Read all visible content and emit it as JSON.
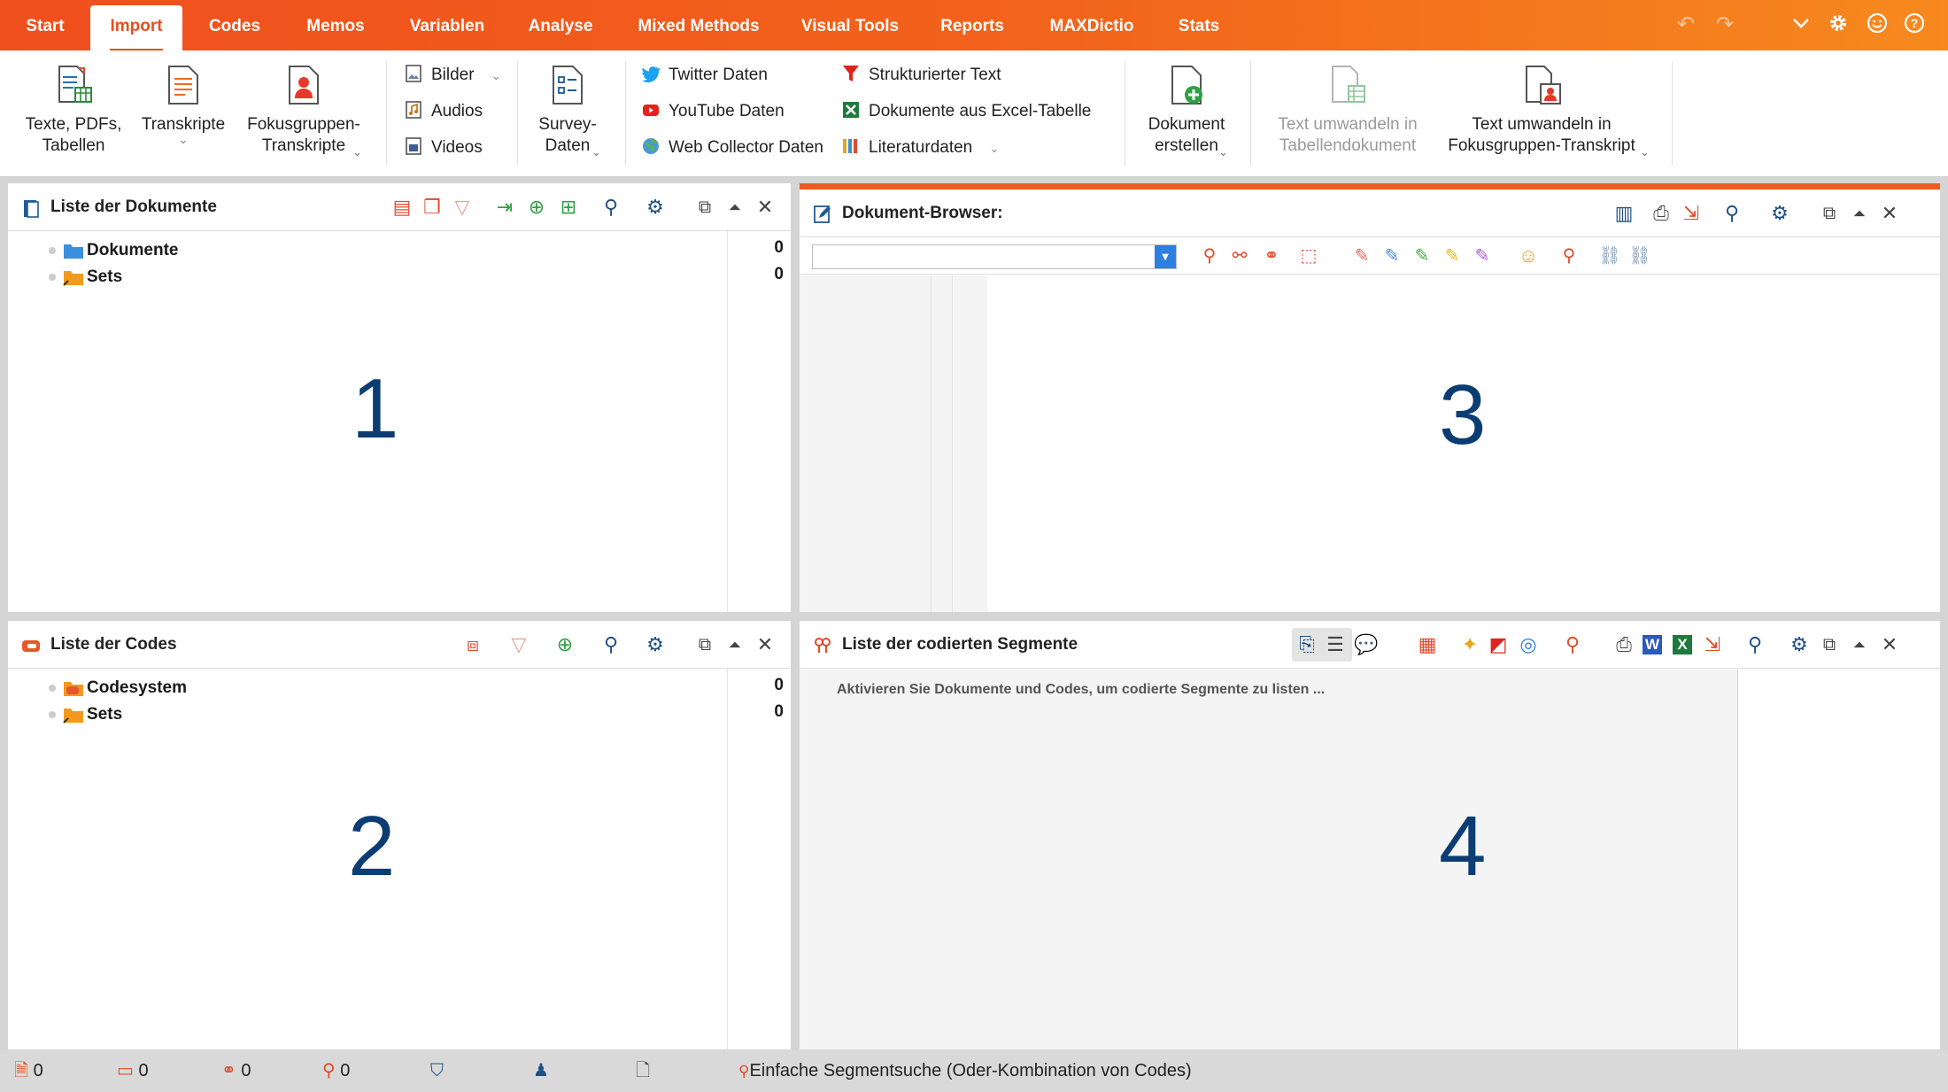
{
  "menubar": {
    "tabs": [
      "Start",
      "Import",
      "Codes",
      "Memos",
      "Variablen",
      "Analyse",
      "Mixed Methods",
      "Visual Tools",
      "Reports",
      "MAXDictio",
      "Stats"
    ],
    "active_tab": "Import"
  },
  "ribbon": {
    "texte_label": "Texte, PDFs,\nTabellen",
    "transkripte_label": "Transkripte",
    "fokus_label": "Fokusgruppen-\nTranskripte",
    "bilder_label": "Bilder",
    "audios_label": "Audios",
    "videos_label": "Videos",
    "survey_label": "Survey-\nDaten",
    "twitter_label": "Twitter Daten",
    "youtube_label": "YouTube Daten",
    "webcollector_label": "Web Collector Daten",
    "strukt_label": "Strukturierter Text",
    "excel_label": "Dokumente aus Excel-Tabelle",
    "literatur_label": "Literaturdaten",
    "dokerstellen_label": "Dokument\nerstellen",
    "tabellendok_label": "Text umwandeln in\nTabellendokument",
    "fokustranskript_label": "Text umwandeln in\nFokusgruppen-Transkript"
  },
  "panels": {
    "documents": {
      "title": "Liste der Dokumente",
      "rows": [
        {
          "label": "Dokumente",
          "count": "0"
        },
        {
          "label": "Sets",
          "count": "0"
        }
      ],
      "number": "1"
    },
    "codes": {
      "title": "Liste der Codes",
      "rows": [
        {
          "label": "Codesystem",
          "count": "0"
        },
        {
          "label": "Sets",
          "count": "0"
        }
      ],
      "number": "2"
    },
    "browser": {
      "title": "Dokument-Browser:",
      "dropdown_value": "",
      "number": "3"
    },
    "segments": {
      "title": "Liste der codierten Segmente",
      "hint": "Aktivieren Sie Dokumente und Codes, um codierte Segmente zu listen ...",
      "number": "4"
    }
  },
  "statusbar": {
    "documents_count": "0",
    "codes_count": "0",
    "segments_count": "0",
    "memos_count": "0",
    "search_mode": "Einfache Segmentsuche (Oder-Kombination von Codes)"
  },
  "colors": {
    "accent": "#ee5a1e",
    "brand_blue": "#0c3d72"
  }
}
